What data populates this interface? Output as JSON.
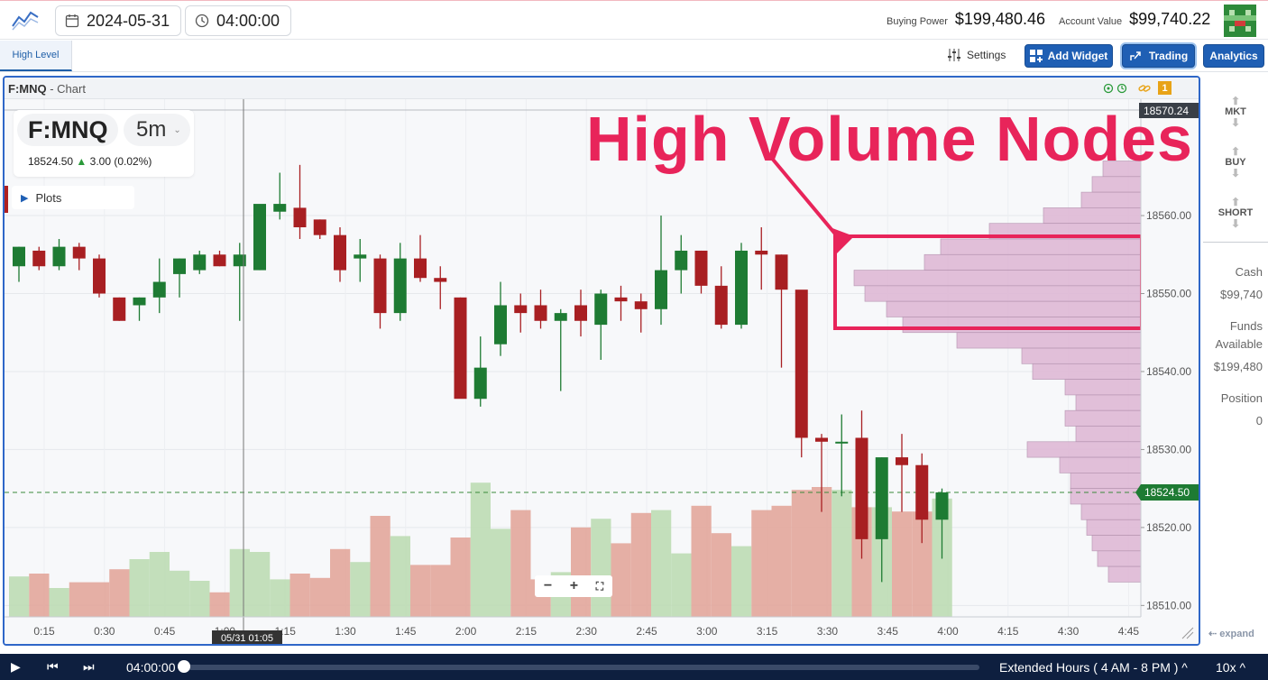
{
  "header": {
    "date": "2024-05-31",
    "time": "04:00:00",
    "buying_power_label": "Buying Power",
    "buying_power_value": "$199,480.46",
    "account_value_label": "Account Value",
    "account_value_value": "$99,740.22"
  },
  "tabs": {
    "active": "High Level",
    "settings_label": "Settings",
    "add_widget_label": "Add Widget",
    "trading_label": "Trading",
    "analytics_label": "Analytics"
  },
  "chart_panel": {
    "symbol_title": "F:MNQ",
    "title_suffix": " - Chart",
    "alert_count": "1",
    "symbol": "F:MNQ",
    "timeframe": "5m",
    "last_price": "18524.50",
    "change": "3.00 (0.02%)",
    "plots_label": "Plots",
    "annotation": "High Volume Nodes",
    "crosshair_time": "05/31 01:05",
    "price_top_label": "18570.24",
    "price_current_label": "18524.50",
    "expand_label": "expand"
  },
  "sidebar": {
    "mkt": "MKT",
    "buy": "BUY",
    "short": "SHORT",
    "cash_label": "Cash",
    "cash_value": "$99,740",
    "funds_label_1": "Funds",
    "funds_label_2": "Available",
    "funds_value": "$199,480",
    "position_label": "Position",
    "position_value": "0"
  },
  "playback": {
    "time": "04:00:00",
    "session": "Extended Hours ( 4 AM - 8 PM )",
    "speed": "10x"
  },
  "colors": {
    "up": "#1e7b33",
    "down": "#a81f22",
    "vol_up": "#bcdcb4",
    "vol_down": "#e2a69b",
    "profile": "#dfb9d6",
    "annotation": "#e8245a",
    "panel_border": "#2f67c8"
  },
  "chart_data": {
    "type": "candlestick",
    "interval": "5m",
    "ylim": [
      18509,
      18574
    ],
    "y_ticks": [
      18510,
      18520,
      18530,
      18540,
      18550,
      18560
    ],
    "x_tick_labels": [
      "0:15",
      "0:30",
      "0:45",
      "1:00",
      "1:15",
      "1:30",
      "1:45",
      "2:00",
      "2:15",
      "2:30",
      "2:45",
      "3:00",
      "3:15",
      "3:30",
      "3:45",
      "4:00",
      "4:15",
      "4:30",
      "4:45"
    ],
    "candles": [
      {
        "o": 18553.5,
        "h": 18556.0,
        "l": 18551.5,
        "c": 18556.0
      },
      {
        "o": 18555.5,
        "h": 18556.0,
        "l": 18553.0,
        "c": 18553.5
      },
      {
        "o": 18553.5,
        "h": 18557.0,
        "l": 18553.0,
        "c": 18556.0
      },
      {
        "o": 18556.0,
        "h": 18556.5,
        "l": 18553.0,
        "c": 18554.5
      },
      {
        "o": 18554.5,
        "h": 18555.0,
        "l": 18549.5,
        "c": 18550.0
      },
      {
        "o": 18549.5,
        "h": 18549.5,
        "l": 18546.5,
        "c": 18546.5
      },
      {
        "o": 18548.5,
        "h": 18549.5,
        "l": 18546.5,
        "c": 18549.5
      },
      {
        "o": 18549.5,
        "h": 18554.5,
        "l": 18547.5,
        "c": 18551.5
      },
      {
        "o": 18552.5,
        "h": 18554.5,
        "l": 18549.5,
        "c": 18554.5
      },
      {
        "o": 18553.0,
        "h": 18555.5,
        "l": 18552.5,
        "c": 18555.0
      },
      {
        "o": 18555.0,
        "h": 18555.5,
        "l": 18553.5,
        "c": 18553.5
      },
      {
        "o": 18553.5,
        "h": 18556.5,
        "l": 18546.5,
        "c": 18555.0
      },
      {
        "o": 18553.0,
        "h": 18560.0,
        "l": 18553.0,
        "c": 18561.5
      },
      {
        "o": 18560.5,
        "h": 18565.5,
        "l": 18559.5,
        "c": 18561.5
      },
      {
        "o": 18561.0,
        "h": 18566.5,
        "l": 18557.0,
        "c": 18558.5
      },
      {
        "o": 18559.5,
        "h": 18559.5,
        "l": 18557.0,
        "c": 18557.5
      },
      {
        "o": 18557.5,
        "h": 18558.5,
        "l": 18551.5,
        "c": 18553.0
      },
      {
        "o": 18554.5,
        "h": 18557.0,
        "l": 18551.5,
        "c": 18555.0
      },
      {
        "o": 18554.5,
        "h": 18555.0,
        "l": 18545.5,
        "c": 18547.5
      },
      {
        "o": 18547.5,
        "h": 18556.5,
        "l": 18546.5,
        "c": 18554.5
      },
      {
        "o": 18554.5,
        "h": 18557.5,
        "l": 18551.5,
        "c": 18552.0
      },
      {
        "o": 18552.0,
        "h": 18553.5,
        "l": 18548.0,
        "c": 18551.5
      },
      {
        "o": 18549.5,
        "h": 18549.5,
        "l": 18537.5,
        "c": 18536.5
      },
      {
        "o": 18536.5,
        "h": 18544.5,
        "l": 18535.5,
        "c": 18540.5
      },
      {
        "o": 18543.5,
        "h": 18551.5,
        "l": 18542.0,
        "c": 18548.5
      },
      {
        "o": 18548.5,
        "h": 18550.0,
        "l": 18545.0,
        "c": 18547.5
      },
      {
        "o": 18548.5,
        "h": 18550.5,
        "l": 18545.5,
        "c": 18546.5
      },
      {
        "o": 18546.5,
        "h": 18548.0,
        "l": 18537.5,
        "c": 18547.5
      },
      {
        "o": 18548.5,
        "h": 18550.5,
        "l": 18544.5,
        "c": 18546.5
      },
      {
        "o": 18546.0,
        "h": 18550.5,
        "l": 18541.5,
        "c": 18550.0
      },
      {
        "o": 18549.5,
        "h": 18551.0,
        "l": 18546.5,
        "c": 18549.0
      },
      {
        "o": 18549.0,
        "h": 18550.0,
        "l": 18545.0,
        "c": 18548.0
      },
      {
        "o": 18548.0,
        "h": 18560.0,
        "l": 18546.0,
        "c": 18553.0
      },
      {
        "o": 18553.0,
        "h": 18557.5,
        "l": 18550.0,
        "c": 18555.5
      },
      {
        "o": 18555.5,
        "h": 18555.5,
        "l": 18550.0,
        "c": 18551.0
      },
      {
        "o": 18551.0,
        "h": 18553.5,
        "l": 18545.5,
        "c": 18546.0
      },
      {
        "o": 18546.0,
        "h": 18556.5,
        "l": 18545.5,
        "c": 18555.5
      },
      {
        "o": 18555.5,
        "h": 18558.5,
        "l": 18550.5,
        "c": 18555.0
      },
      {
        "o": 18555.0,
        "h": 18555.0,
        "l": 18540.5,
        "c": 18550.5
      },
      {
        "o": 18550.5,
        "h": 18550.0,
        "l": 18529.0,
        "c": 18531.5
      },
      {
        "o": 18531.5,
        "h": 18532.0,
        "l": 18522.0,
        "c": 18531.0
      },
      {
        "o": 18531.0,
        "h": 18534.5,
        "l": 18524.0,
        "c": 18531.0
      },
      {
        "o": 18531.5,
        "h": 18535.0,
        "l": 18516.0,
        "c": 18518.5
      },
      {
        "o": 18518.5,
        "h": 18529.0,
        "l": 18513.0,
        "c": 18529.0
      },
      {
        "o": 18529.0,
        "h": 18532.0,
        "l": 18522.0,
        "c": 18528.0
      },
      {
        "o": 18528.0,
        "h": 18529.5,
        "l": 18518.0,
        "c": 18521.0
      },
      {
        "o": 18521.0,
        "h": 18525.0,
        "l": 18516.0,
        "c": 18524.5
      }
    ],
    "volume_relative": [
      0.28,
      0.3,
      0.2,
      0.24,
      0.24,
      0.33,
      0.4,
      0.45,
      0.32,
      0.25,
      0.17,
      0.47,
      0.45,
      0.26,
      0.3,
      0.27,
      0.47,
      0.38,
      0.7,
      0.56,
      0.36,
      0.36,
      0.55,
      0.93,
      0.61,
      0.74,
      0.26,
      0.31,
      0.62,
      0.68,
      0.51,
      0.72,
      0.74,
      0.44,
      0.77,
      0.58,
      0.49,
      0.74,
      0.77,
      0.88,
      0.9,
      0.88,
      0.76,
      0.76,
      0.73,
      0.73,
      0.82
    ],
    "volume_profile": [
      {
        "price": 18566,
        "width": 0.35
      },
      {
        "price": 18564,
        "width": 0.45
      },
      {
        "price": 18562,
        "width": 0.55
      },
      {
        "price": 18560,
        "width": 0.9
      },
      {
        "price": 18558,
        "width": 1.4
      },
      {
        "price": 18556,
        "width": 1.85
      },
      {
        "price": 18554,
        "width": 2.0
      },
      {
        "price": 18552,
        "width": 2.65
      },
      {
        "price": 18550,
        "width": 2.55
      },
      {
        "price": 18548,
        "width": 2.35
      },
      {
        "price": 18546,
        "width": 2.2
      },
      {
        "price": 18544,
        "width": 1.7
      },
      {
        "price": 18542,
        "width": 1.1
      },
      {
        "price": 18540,
        "width": 1.0
      },
      {
        "price": 18538,
        "width": 0.7
      },
      {
        "price": 18536,
        "width": 0.6
      },
      {
        "price": 18534,
        "width": 0.7
      },
      {
        "price": 18532,
        "width": 0.6
      },
      {
        "price": 18530,
        "width": 1.05
      },
      {
        "price": 18528,
        "width": 0.75
      },
      {
        "price": 18526,
        "width": 0.65
      },
      {
        "price": 18524,
        "width": 0.65
      },
      {
        "price": 18522,
        "width": 0.55
      },
      {
        "price": 18520,
        "width": 0.5
      },
      {
        "price": 18518,
        "width": 0.45
      },
      {
        "price": 18516,
        "width": 0.4
      },
      {
        "price": 18514,
        "width": 0.3
      }
    ]
  }
}
